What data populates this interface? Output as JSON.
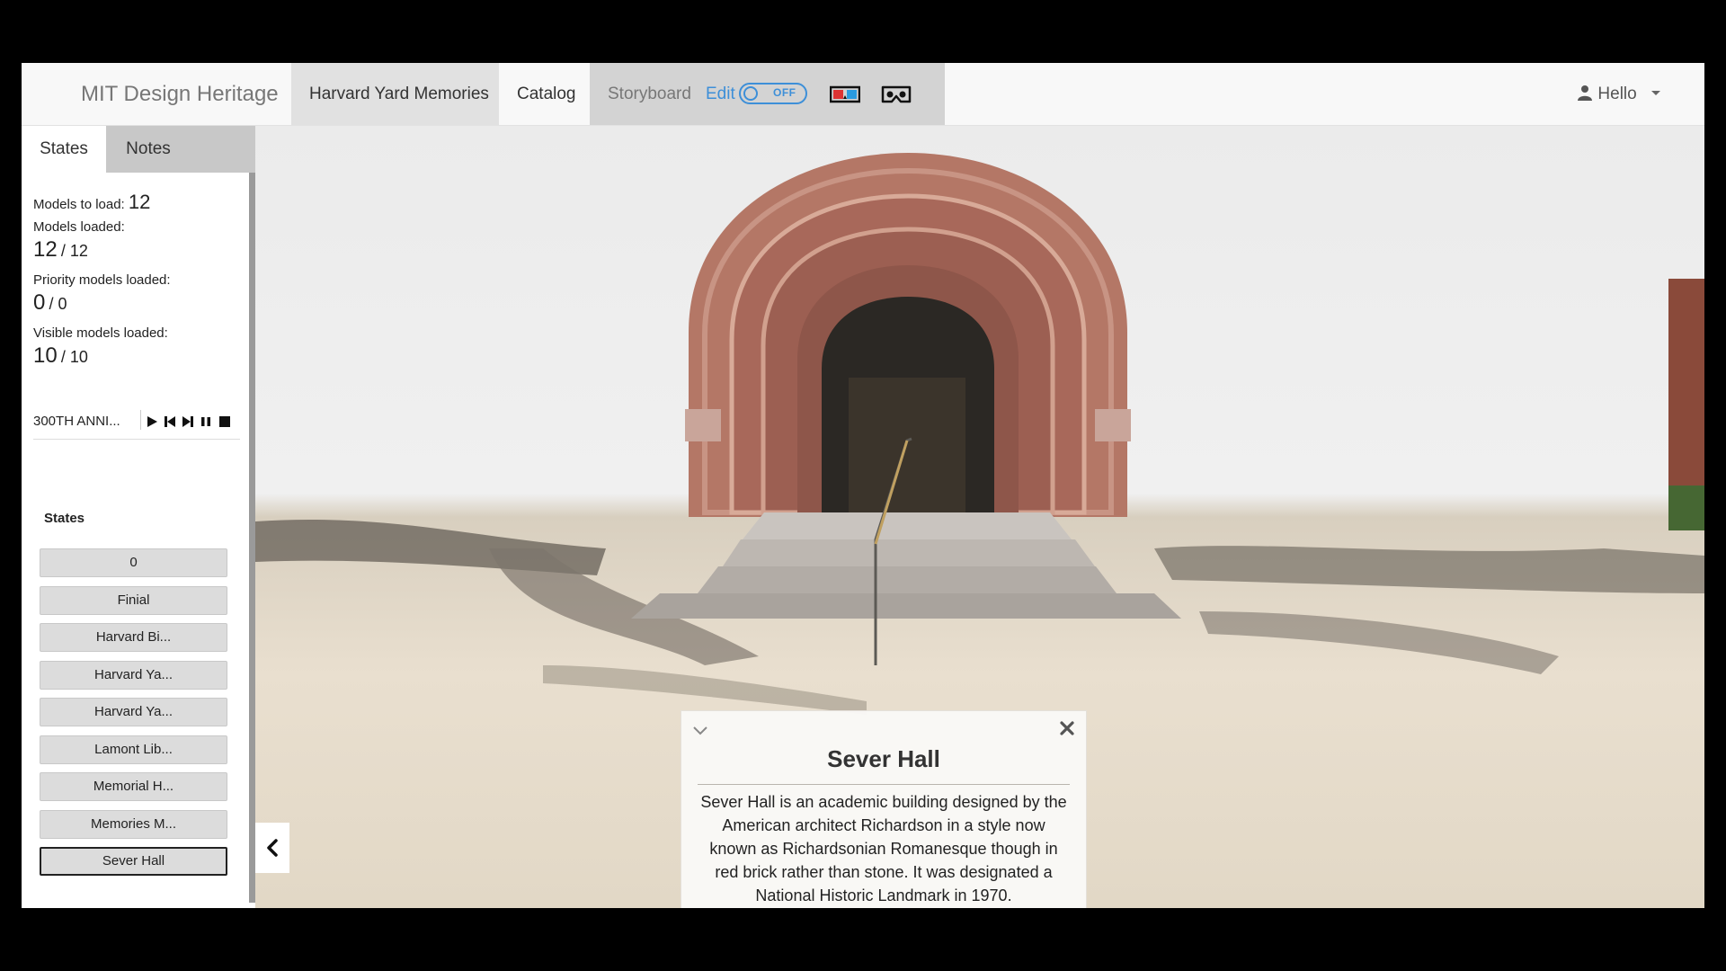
{
  "nav": {
    "brand": "MIT Design Heritage",
    "items": [
      "Harvard Yard Memories",
      "Catalog"
    ],
    "storyboard": "Storyboard",
    "edit": "Edit",
    "toggle_state": "OFF",
    "user": "Hello"
  },
  "sidebar": {
    "tabs": [
      "States",
      "Notes"
    ],
    "models_to_load_label": "Models to load:",
    "models_to_load": "12",
    "models_loaded_label": "Models loaded:",
    "models_loaded": "12",
    "models_loaded_total": "12",
    "priority_label": "Priority models loaded:",
    "priority_loaded": "0",
    "priority_total": "0",
    "visible_label": "Visible models loaded:",
    "visible_loaded": "10",
    "visible_total": "10",
    "story_name": "300TH ANNI...",
    "states_title": "States",
    "states": [
      "0",
      "Finial",
      "Harvard Bi...",
      "Harvard Ya...",
      "Harvard Ya...",
      "Lamont Lib...",
      "Memorial H...",
      "Memories M...",
      "Sever Hall"
    ],
    "selected_state": "Sever Hall"
  },
  "info_panel": {
    "title": "Sever Hall",
    "body": "Sever Hall is an academic building designed by the American architect Richardson in a style now known as Richardsonian Romanesque though in red brick rather than stone. It was designated a National Historic Landmark in 1970."
  },
  "colors": {
    "accent": "#3d8fd8",
    "brick": "#b47766"
  }
}
